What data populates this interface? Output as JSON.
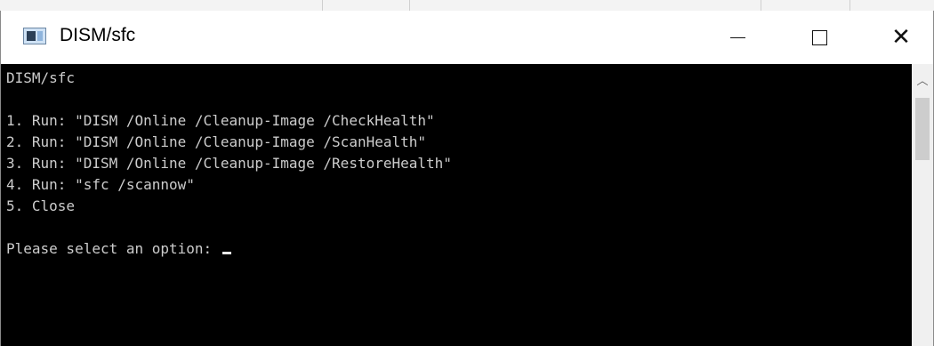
{
  "window": {
    "title": "DISM/sfc"
  },
  "console": {
    "heading": "DISM/sfc",
    "menu": [
      "1. Run: \"DISM /Online /Cleanup-Image /CheckHealth\"",
      "2. Run: \"DISM /Online /Cleanup-Image /ScanHealth\"",
      "3. Run: \"DISM /Online /Cleanup-Image /RestoreHealth\"",
      "4. Run: \"sfc /scannow\"",
      "5. Close"
    ],
    "prompt": "Please select an option: "
  },
  "icons": {
    "minimize": "minimize-icon",
    "maximize": "maximize-icon",
    "close": "close-icon",
    "scroll_up": "chevron-up-icon"
  },
  "colors": {
    "console_bg": "#000000",
    "console_text": "#cccccc",
    "titlebar_bg": "#ffffff"
  }
}
